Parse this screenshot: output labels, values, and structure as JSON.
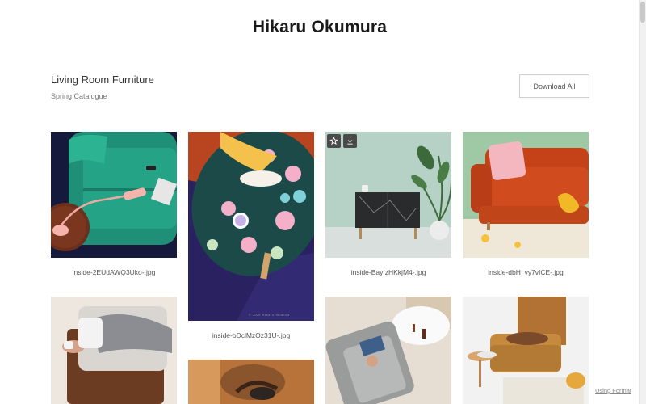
{
  "site": {
    "title": "Hikaru Okumura"
  },
  "gallery": {
    "title": "Living Room Furniture",
    "subtitle": "Spring Catalogue",
    "download_all_label": "Download All"
  },
  "photos": [
    {
      "caption": "inside-2EUdAWQ3Uko-.jpg",
      "icon": ""
    },
    {
      "caption": "inside-oDclMzOz31U-.jpg",
      "icon": ""
    },
    {
      "caption": "inside-BayIzHKkjM4-.jpg",
      "icon": ""
    },
    {
      "caption": "inside-dbH_vy7vICE-.jpg",
      "icon": ""
    }
  ],
  "photo_actions": {
    "favorite_icon": "star-icon",
    "download_icon": "download-icon"
  },
  "footer": {
    "using_format": "Using Format"
  }
}
